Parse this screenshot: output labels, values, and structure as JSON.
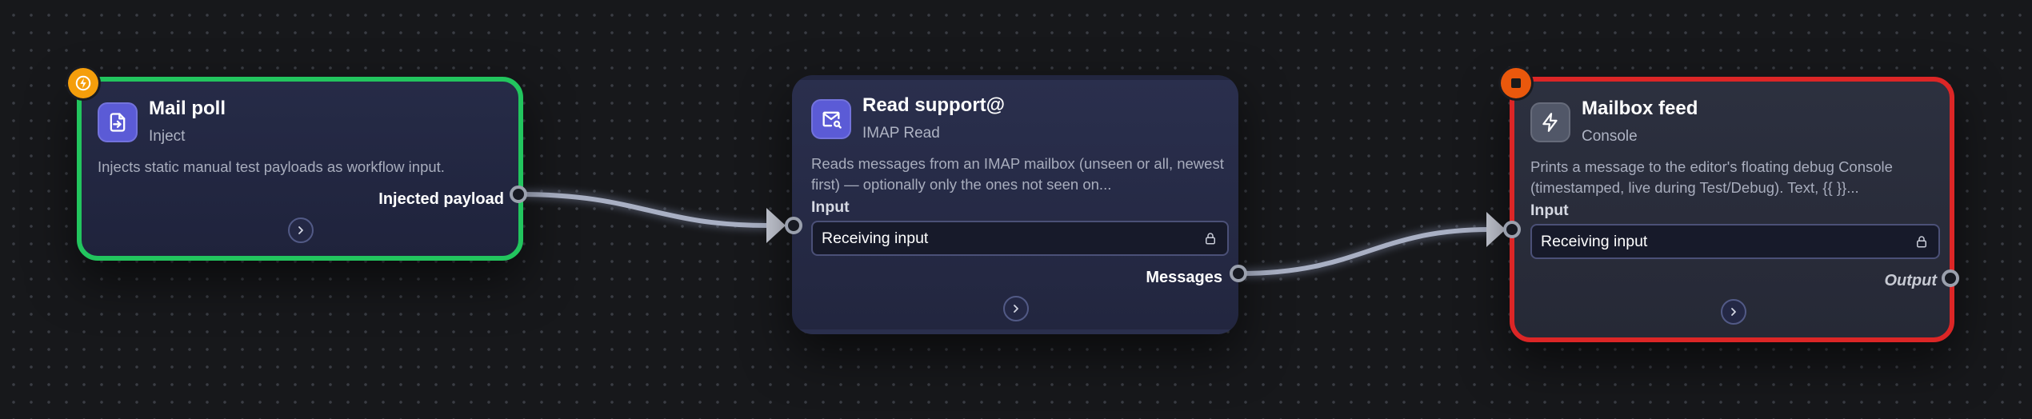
{
  "nodes": {
    "mail_poll": {
      "title": "Mail poll",
      "subtitle": "Inject",
      "description": "Injects static manual test payloads as workflow input.",
      "output_label": "Injected payload",
      "icon": "file-import-icon",
      "badge": "bolt-icon",
      "status_color": "#22c55e"
    },
    "read_support": {
      "title": "Read support@",
      "subtitle": "IMAP Read",
      "description": "Reads messages from an IMAP mailbox (unseen or all, newest first) — optionally only the ones not seen on...",
      "input_label": "Input",
      "input_value": "Receiving input",
      "output_label": "Messages",
      "icon": "mail-search-icon"
    },
    "mailbox_feed": {
      "title": "Mailbox feed",
      "subtitle": "Console",
      "description": "Prints a message to the editor's floating debug Console (timestamped, live during Test/Debug). Text, {{ }}...",
      "input_label": "Input",
      "input_value": "Receiving input",
      "output_label": "Output",
      "icon": "bolt-icon",
      "badge": "stop-icon",
      "status_color": "#dc2626"
    }
  },
  "colors": {
    "accent": "#5b5bd6",
    "success": "#22c55e",
    "error": "#dc2626",
    "badge_orange": "#f59e0b"
  }
}
